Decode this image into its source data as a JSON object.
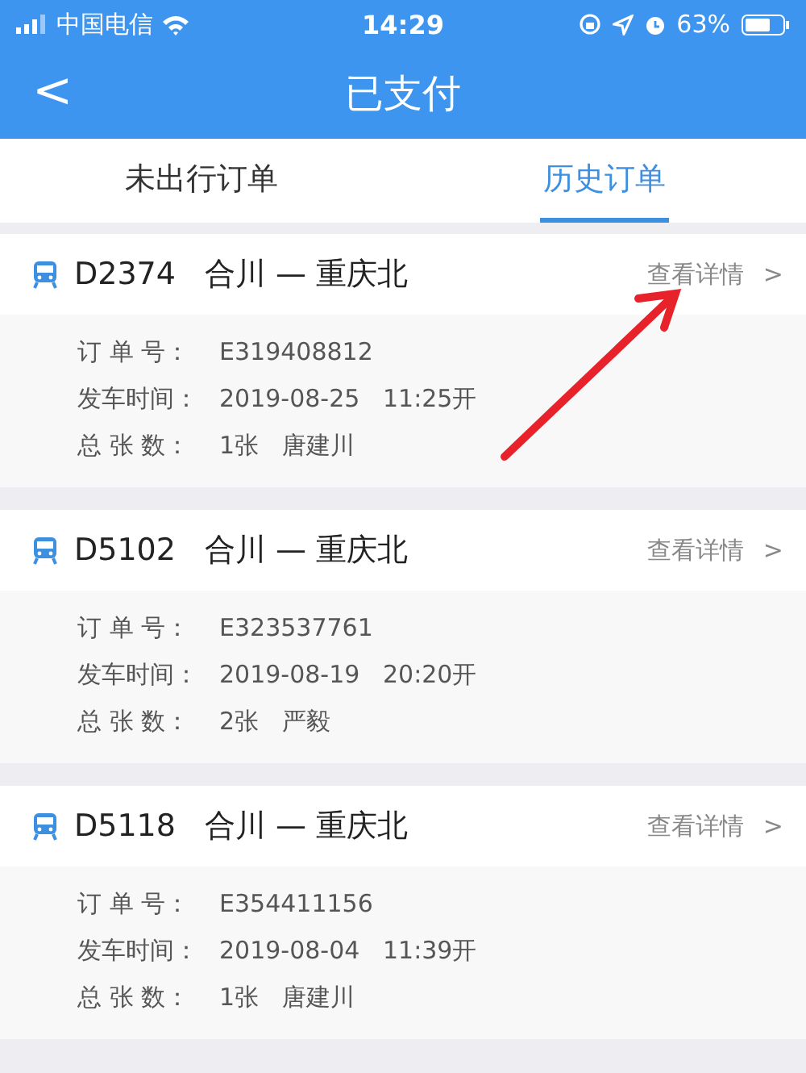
{
  "status_bar": {
    "carrier": "中国电信",
    "time": "14:29",
    "battery": "63%"
  },
  "nav": {
    "back": "<",
    "title": "已支付"
  },
  "tabs": [
    {
      "label": "未出行订单",
      "selected": false
    },
    {
      "label": "历史订单",
      "selected": true
    }
  ],
  "orders": [
    {
      "train": "D2374",
      "route": "合川 — 重庆北",
      "link": "查看详情",
      "chevron": ">",
      "fields": [
        {
          "label": "订 单 号：",
          "value": "E319408812"
        },
        {
          "label": "发车时间：",
          "value": "2019-08-25   11:25开"
        },
        {
          "label": "总 张 数：",
          "value": "1张   唐建川"
        }
      ]
    },
    {
      "train": "D5102",
      "route": "合川 — 重庆北",
      "link": "查看详情",
      "chevron": ">",
      "fields": [
        {
          "label": "订 单 号：",
          "value": "E323537761"
        },
        {
          "label": "发车时间：",
          "value": "2019-08-19   20:20开"
        },
        {
          "label": "总 张 数：",
          "value": "2张   严毅"
        }
      ]
    },
    {
      "train": "D5118",
      "route": "合川 — 重庆北",
      "link": "查看详情",
      "chevron": ">",
      "fields": [
        {
          "label": "订 单 号：",
          "value": "E354411156"
        },
        {
          "label": "发车时间：",
          "value": "2019-08-04   11:39开"
        },
        {
          "label": "总 张 数：",
          "value": "1张   唐建川"
        }
      ]
    }
  ]
}
